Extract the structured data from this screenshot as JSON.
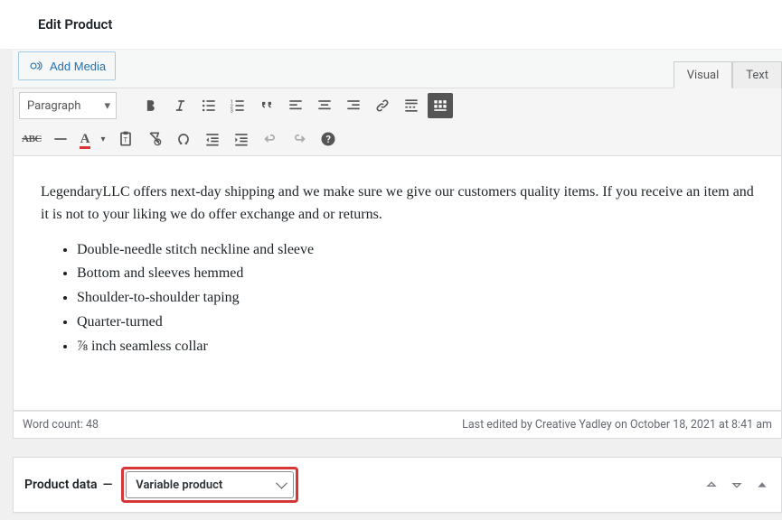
{
  "page": {
    "title": "Edit Product"
  },
  "editor": {
    "add_media_label": "Add Media",
    "tabs": {
      "visual": "Visual",
      "text": "Text"
    },
    "format_label": "Paragraph",
    "abc_label": "ABC",
    "textcolor_label": "A"
  },
  "content": {
    "paragraph": "LegendaryLLC offers next-day shipping and we make sure we give our customers quality items. If you receive an item and it is not to your liking we do offer exchange and or returns.",
    "bullets": [
      "Double-needle stitch neckline and sleeve",
      "Bottom and sleeves hemmed",
      "Shoulder-to-shoulder taping",
      "Quarter-turned",
      "⅞ inch seamless collar"
    ]
  },
  "status": {
    "word_count_label": "Word count: 48",
    "last_edited": "Last edited by Creative Yadley on October 18, 2021 at 8:41 am"
  },
  "product_data": {
    "label": "Product data",
    "dash": "—",
    "selected": "Variable product"
  }
}
